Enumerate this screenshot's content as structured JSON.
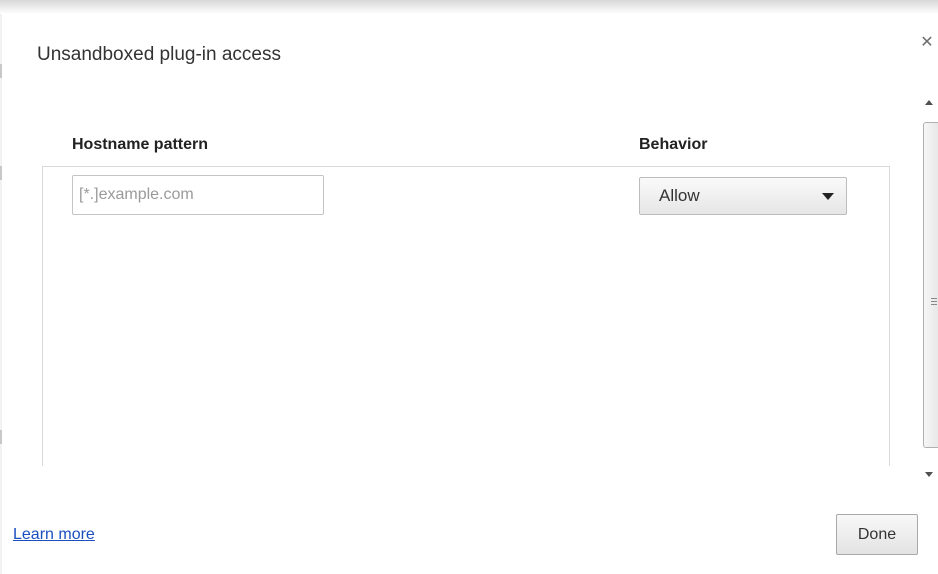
{
  "dialog": {
    "title": "Unsandboxed plug-in access",
    "close_icon": "close-icon"
  },
  "table": {
    "columns": [
      "Hostname pattern",
      "Behavior"
    ],
    "new_row": {
      "hostname_value": "",
      "hostname_placeholder": "[*.]example.com",
      "behavior_selected": "Allow"
    }
  },
  "footer": {
    "learn_more_label": "Learn more",
    "done_label": "Done"
  },
  "colors": {
    "link": "#1a4fbf",
    "text": "#333333",
    "border": "#d9d9d9"
  }
}
